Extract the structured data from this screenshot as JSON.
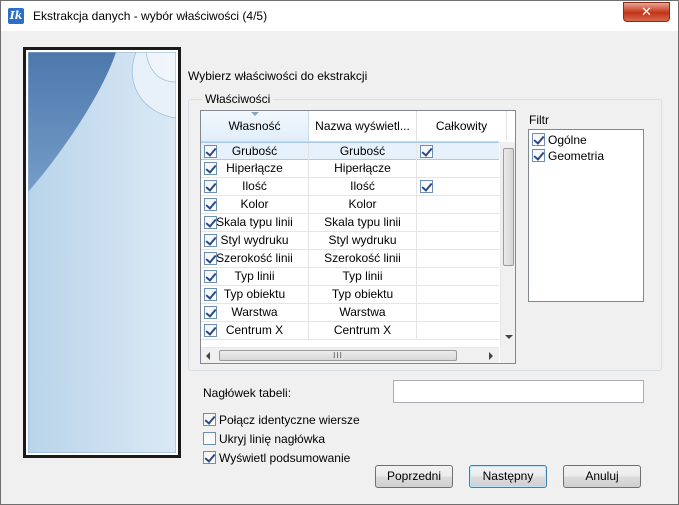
{
  "window": {
    "title": "Ekstrakcja danych - wybór właściwości (4/5)",
    "close_glyph": "✕",
    "app_icon_glyph": "Ik"
  },
  "heading": "Wybierz właściwości do ekstrakcji",
  "group_label": "Właściwości",
  "grid": {
    "columns": [
      "Własność",
      "Nazwa wyświetl...",
      "Całkowity"
    ],
    "rows": [
      {
        "checked": true,
        "property": "Grubość",
        "display": "Grubość",
        "total": true
      },
      {
        "checked": true,
        "property": "Hiperłącze",
        "display": "Hiperłącze",
        "total": false
      },
      {
        "checked": true,
        "property": "Ilość",
        "display": "Ilość",
        "total": true
      },
      {
        "checked": true,
        "property": "Kolor",
        "display": "Kolor",
        "total": false
      },
      {
        "checked": true,
        "property": "Skala typu linii",
        "display": "Skala typu linii",
        "total": false
      },
      {
        "checked": true,
        "property": "Styl wydruku",
        "display": "Styl wydruku",
        "total": false
      },
      {
        "checked": true,
        "property": "Szerokość linii",
        "display": "Szerokość linii",
        "total": false
      },
      {
        "checked": true,
        "property": "Typ linii",
        "display": "Typ linii",
        "total": false
      },
      {
        "checked": true,
        "property": "Typ obiektu",
        "display": "Typ obiektu",
        "total": false
      },
      {
        "checked": true,
        "property": "Warstwa",
        "display": "Warstwa",
        "total": false
      },
      {
        "checked": true,
        "property": "Centrum X",
        "display": "Centrum X",
        "total": false
      }
    ],
    "hscroll_grip": "III"
  },
  "filter": {
    "label": "Filtr",
    "items": [
      {
        "label": "Ogólne",
        "checked": true
      },
      {
        "label": "Geometria",
        "checked": true
      }
    ]
  },
  "table_header": {
    "label": "Nagłówek tabeli:",
    "value": ""
  },
  "options": [
    {
      "label": "Połącz identyczne wiersze",
      "checked": true
    },
    {
      "label": "Ukryj linię nagłówka",
      "checked": false
    },
    {
      "label": "Wyświetl podsumowanie",
      "checked": true
    }
  ],
  "buttons": {
    "back": "Poprzedni",
    "next": "Następny",
    "cancel": "Anuluj"
  },
  "colors": {
    "accent": "#3c7fb1",
    "wizard_blue": "#4a78b0",
    "close_red": "#c9462c"
  }
}
